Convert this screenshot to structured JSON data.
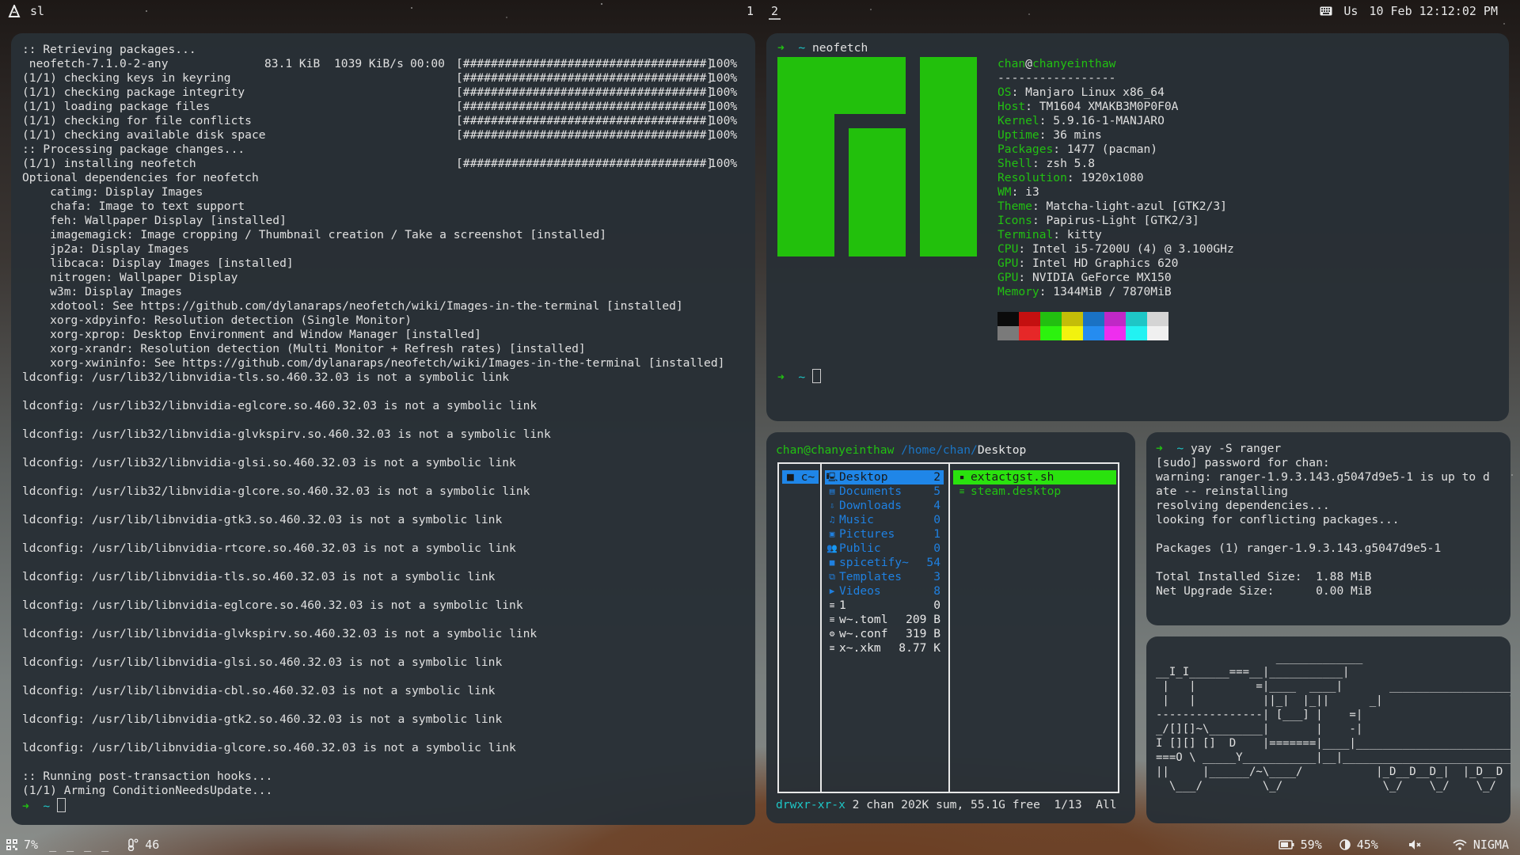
{
  "topbar": {
    "app_icon": "manjaro-icon",
    "window_title": "sl",
    "workspaces": [
      "1",
      "2"
    ],
    "active_workspace": "2",
    "keyboard_icon": "keyboard-icon",
    "keyboard_layout": "Us",
    "datetime": "10 Feb 12:12:02 PM"
  },
  "bottombar": {
    "cpu_icon": "cpu-icon",
    "cpu": "7%",
    "cpu_graph": "_ _ _ _",
    "temp_icon": "thermometer-icon",
    "temp": "46",
    "battery_icon": "battery-icon",
    "battery": "59%",
    "brightness_icon": "brightness-icon",
    "brightness": "45%",
    "volume_icon": "volume-muted-icon",
    "wifi_icon": "wifi-icon",
    "network": "NIGMA"
  },
  "pacman_terminal": {
    "header": ":: Retrieving packages...",
    "download": {
      "name": " neofetch-7.1.0-2-any",
      "size": "83.1 KiB",
      "speed": "1039 KiB/s",
      "time": "00:00",
      "bar": "[###################################]",
      "percent": "100%"
    },
    "progress_rows": [
      {
        "label": "(1/1) checking keys in keyring",
        "bar": "[###################################]",
        "percent": "100%"
      },
      {
        "label": "(1/1) checking package integrity",
        "bar": "[###################################]",
        "percent": "100%"
      },
      {
        "label": "(1/1) loading package files",
        "bar": "[###################################]",
        "percent": "100%"
      },
      {
        "label": "(1/1) checking for file conflicts",
        "bar": "[###################################]",
        "percent": "100%"
      },
      {
        "label": "(1/1) checking available disk space",
        "bar": "[###################################]",
        "percent": "100%"
      }
    ],
    "processing": ":: Processing package changes...",
    "install_row": {
      "label": "(1/1) installing neofetch",
      "bar": "[###################################]",
      "percent": "100%"
    },
    "optional_header": "Optional dependencies for neofetch",
    "optional_deps": [
      "    catimg: Display Images",
      "    chafa: Image to text support",
      "    feh: Wallpaper Display [installed]",
      "    imagemagick: Image cropping / Thumbnail creation / Take a screenshot [installed]",
      "    jp2a: Display Images",
      "    libcaca: Display Images [installed]",
      "    nitrogen: Wallpaper Display",
      "    w3m: Display Images",
      "    xdotool: See https://github.com/dylanaraps/neofetch/wiki/Images-in-the-terminal [installed]",
      "    xorg-xdpyinfo: Resolution detection (Single Monitor)",
      "    xorg-xprop: Desktop Environment and Window Manager [installed]",
      "    xorg-xrandr: Resolution detection (Multi Monitor + Refresh rates) [installed]",
      "    xorg-xwininfo: See https://github.com/dylanaraps/neofetch/wiki/Images-in-the-terminal [installed]"
    ],
    "ldconfig_lines": [
      "ldconfig: /usr/lib32/libnvidia-tls.so.460.32.03 is not a symbolic link",
      "ldconfig: /usr/lib32/libnvidia-eglcore.so.460.32.03 is not a symbolic link",
      "ldconfig: /usr/lib32/libnvidia-glvkspirv.so.460.32.03 is not a symbolic link",
      "ldconfig: /usr/lib32/libnvidia-glsi.so.460.32.03 is not a symbolic link",
      "ldconfig: /usr/lib32/libnvidia-glcore.so.460.32.03 is not a symbolic link",
      "ldconfig: /usr/lib/libnvidia-gtk3.so.460.32.03 is not a symbolic link",
      "ldconfig: /usr/lib/libnvidia-rtcore.so.460.32.03 is not a symbolic link",
      "ldconfig: /usr/lib/libnvidia-tls.so.460.32.03 is not a symbolic link",
      "ldconfig: /usr/lib/libnvidia-eglcore.so.460.32.03 is not a symbolic link",
      "ldconfig: /usr/lib/libnvidia-glvkspirv.so.460.32.03 is not a symbolic link",
      "ldconfig: /usr/lib/libnvidia-glsi.so.460.32.03 is not a symbolic link",
      "ldconfig: /usr/lib/libnvidia-cbl.so.460.32.03 is not a symbolic link",
      "ldconfig: /usr/lib/libnvidia-gtk2.so.460.32.03 is not a symbolic link",
      "ldconfig: /usr/lib/libnvidia-glcore.so.460.32.03 is not a symbolic link"
    ],
    "hooks": ":: Running post-transaction hooks...",
    "arming": "(1/1) Arming ConditionNeedsUpdate...",
    "prompt_arrow": "➜",
    "prompt_dir": "~"
  },
  "neofetch_terminal": {
    "prompt_arrow": "➜",
    "prompt_dir": "~",
    "command": "neofetch",
    "user": "chan",
    "at": "@",
    "host": "chanyeinthaw",
    "separator": "-----------------",
    "fields": [
      {
        "key": "OS",
        "value": "Manjaro Linux x86_64"
      },
      {
        "key": "Host",
        "value": "TM1604 XMAKB3M0P0F0A"
      },
      {
        "key": "Kernel",
        "value": "5.9.16-1-MANJARO"
      },
      {
        "key": "Uptime",
        "value": "36 mins"
      },
      {
        "key": "Packages",
        "value": "1477 (pacman)"
      },
      {
        "key": "Shell",
        "value": "zsh 5.8"
      },
      {
        "key": "Resolution",
        "value": "1920x1080"
      },
      {
        "key": "WM",
        "value": "i3"
      },
      {
        "key": "Theme",
        "value": "Matcha-light-azul [GTK2/3]"
      },
      {
        "key": "Icons",
        "value": "Papirus-Light [GTK2/3]"
      },
      {
        "key": "Terminal",
        "value": "kitty"
      },
      {
        "key": "CPU",
        "value": "Intel i5-7200U (4) @ 3.100GHz"
      },
      {
        "key": "GPU",
        "value": "Intel HD Graphics 620"
      },
      {
        "key": "GPU",
        "value": "NVIDIA GeForce MX150"
      },
      {
        "key": "Memory",
        "value": "1344MiB / 7870MiB"
      }
    ],
    "palette": [
      "#0b0b0b",
      "#c41010",
      "#22bf10",
      "#c4bd08",
      "#1a72c4",
      "#c028c6",
      "#1ec6c6",
      "#d4d4d4",
      "#7a7a7a",
      "#e62828",
      "#2cf20e",
      "#f2f20e",
      "#258cf0",
      "#ee2eee",
      "#22f2f2",
      "#f0f0f0"
    ],
    "logo_color": "#22c00c"
  },
  "ranger": {
    "user_host": "chan@chanyeinthaw",
    "path_prefix": "/home/chan/",
    "path_current": "Desktop",
    "parent": {
      "icon": "folder-icon",
      "label": "c~"
    },
    "items": [
      {
        "icon": "desktop-icon",
        "glyph": "🖳",
        "name": "Desktop",
        "size": "2",
        "type": "dir",
        "selected": true
      },
      {
        "icon": "documents-icon",
        "glyph": "▤",
        "name": "Documents",
        "size": "5",
        "type": "dir"
      },
      {
        "icon": "downloads-icon",
        "glyph": "⇩",
        "name": "Downloads",
        "size": "4",
        "type": "dir"
      },
      {
        "icon": "music-icon",
        "glyph": "♫",
        "name": "Music",
        "size": "0",
        "type": "dir"
      },
      {
        "icon": "pictures-icon",
        "glyph": "▣",
        "name": "Pictures",
        "size": "1",
        "type": "dir"
      },
      {
        "icon": "public-icon",
        "glyph": "👥",
        "name": "Public",
        "size": "0",
        "type": "dir"
      },
      {
        "icon": "folder-icon",
        "glyph": "■",
        "name": "spicetify~",
        "size": "54",
        "type": "dir"
      },
      {
        "icon": "templates-icon",
        "glyph": "⧉",
        "name": "Templates",
        "size": "3",
        "type": "dir"
      },
      {
        "icon": "videos-icon",
        "glyph": "▶",
        "name": "Videos",
        "size": "8",
        "type": "dir"
      },
      {
        "icon": "file-icon",
        "glyph": "≡",
        "name": "1",
        "size": "0",
        "type": "file"
      },
      {
        "icon": "file-icon",
        "glyph": "≡",
        "name": "w~.toml",
        "size": "209 B",
        "type": "file"
      },
      {
        "icon": "gear-icon",
        "glyph": "⚙",
        "name": "w~.conf",
        "size": "319 B",
        "type": "file"
      },
      {
        "icon": "file-icon",
        "glyph": "≡",
        "name": "x~.xkm",
        "size": "8.77 K",
        "type": "file"
      }
    ],
    "preview": [
      {
        "icon": "terminal-file-icon",
        "glyph": "▪",
        "name": "extactgst.sh",
        "selected": true
      },
      {
        "icon": "file-icon",
        "glyph": "≡",
        "name": "steam.desktop"
      }
    ],
    "status": {
      "permissions": "drwxr-xr-x",
      "info": "2 chan 202K sum, 55.1G free",
      "position": "1/13",
      "scroll": "All"
    }
  },
  "yay_terminal": {
    "prompt_arrow": "➜",
    "prompt_dir": "~",
    "command": "yay -S ranger",
    "lines": [
      "[sudo] password for chan:",
      "warning: ranger-1.9.3.143.g5047d9e5-1 is up to d",
      "ate -- reinstalling",
      "resolving dependencies...",
      "looking for conflicting packages...",
      "",
      "Packages (1) ranger-1.9.3.143.g5047d9e5-1",
      "",
      "Total Installed Size:  1.88 MiB",
      "Net Upgrade Size:      0.00 MiB"
    ]
  },
  "sl_terminal": {
    "art": "                  _____________\n__I_I______===__|___________|\n |   |         =|____  ____|       ___________________\n |   |          ||_|  |_||      _|                   \\\n----------------| [___] |    =|\n_/[][]~\\________|       |    -|\nI [][] []  D    |=======|____|________________________\n===O \\ _____Y___________|__|__________________________\n||     |______/~\\____/           |_D__D__D_|  |_D__D\n  \\___/         \\_/               \\_/    \\_/    \\_/"
  }
}
